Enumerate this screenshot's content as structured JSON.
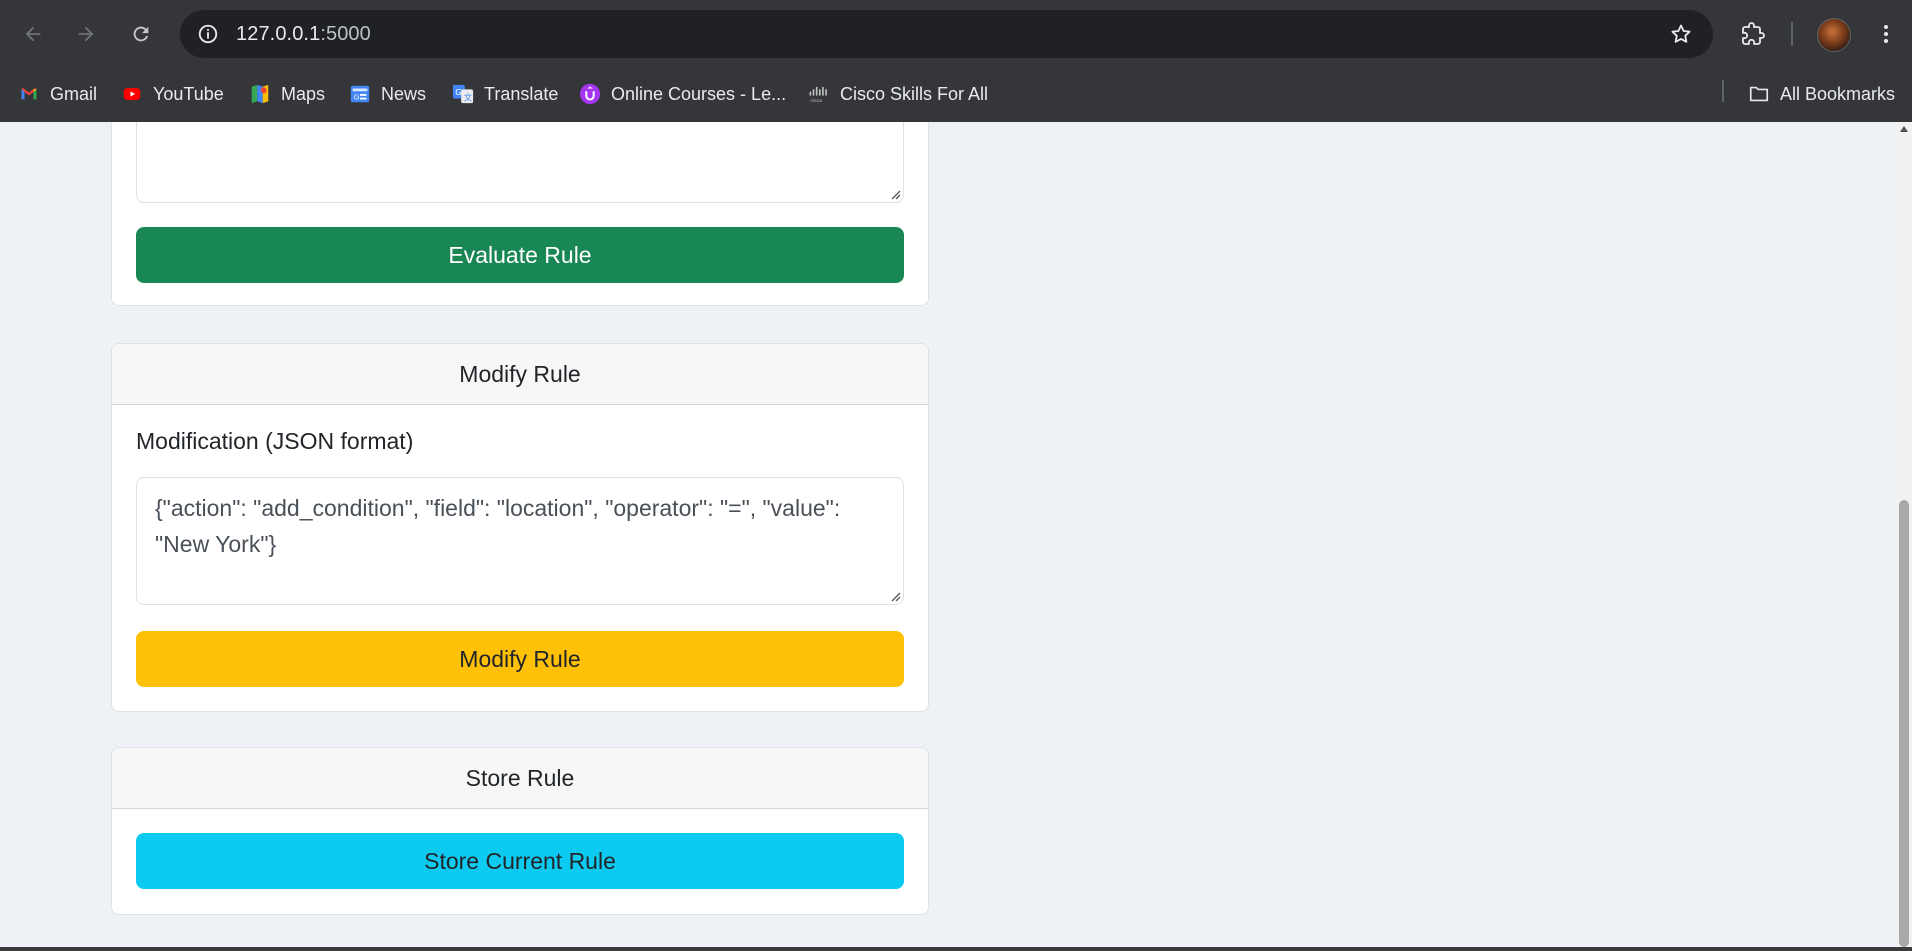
{
  "browser": {
    "url_host": "127.0.0.1",
    "url_port": ":5000",
    "bookmarks": [
      {
        "label": "Gmail",
        "icon": "gmail-icon"
      },
      {
        "label": "YouTube",
        "icon": "youtube-icon"
      },
      {
        "label": "Maps",
        "icon": "maps-icon"
      },
      {
        "label": "News",
        "icon": "news-icon"
      },
      {
        "label": "Translate",
        "icon": "translate-icon"
      },
      {
        "label": "Online Courses - Le...",
        "icon": "udemy-icon"
      },
      {
        "label": "Cisco Skills For All",
        "icon": "cisco-icon"
      }
    ],
    "all_bookmarks": "All Bookmarks"
  },
  "evaluate": {
    "button_label": "Evaluate Rule"
  },
  "modify": {
    "title": "Modify Rule",
    "field_label": "Modification (JSON format)",
    "field_value": "{\"action\": \"add_condition\", \"field\": \"location\", \"operator\": \"=\", \"value\": \"New York\"}",
    "button_label": "Modify Rule"
  },
  "store": {
    "title": "Store Rule",
    "button_label": "Store Current Rule"
  },
  "colors": {
    "evaluate_button": "#198754",
    "modify_button": "#ffc107",
    "store_button": "#0dcaf0",
    "page_background": "#eef1f6",
    "chrome_background": "#35363a"
  }
}
